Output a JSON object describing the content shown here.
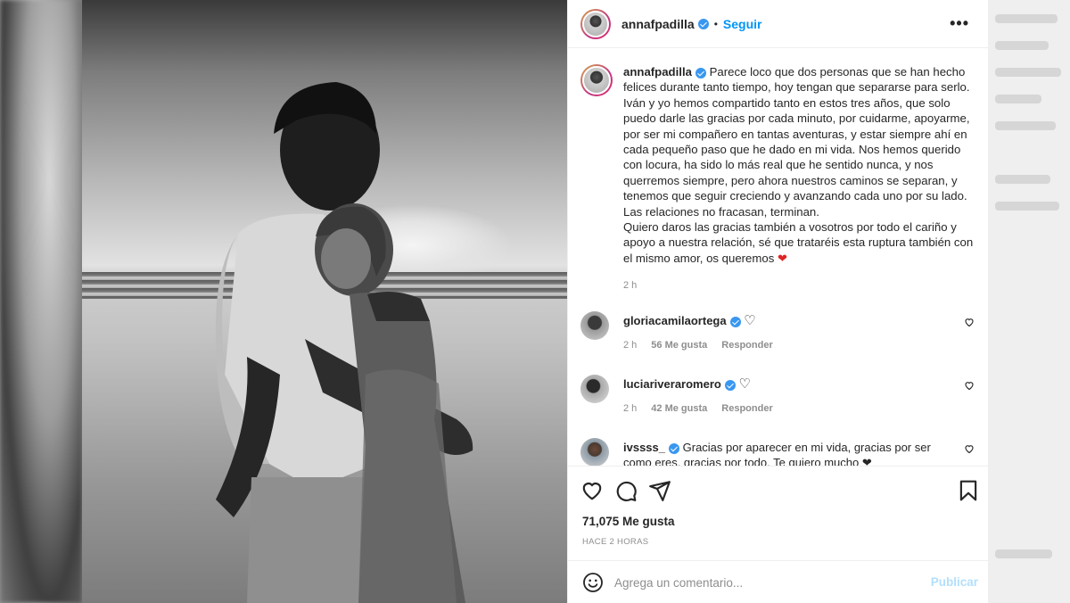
{
  "post": {
    "author": "annafpadilla",
    "follow_label": "Seguir",
    "separator": "•",
    "more_label": "•••",
    "caption_author": "annafpadilla",
    "caption": "Parece loco que dos personas que se han hecho felices durante tanto tiempo, hoy tengan que separarse para serlo. Iván y yo hemos compartido tanto en estos tres años, que solo puedo darle las gracias por cada minuto, por cuidarme, apoyarme, por ser mi compañero en tantas aventuras, y estar siempre ahí en cada pequeño paso que he dado en mi vida. Nos hemos querido con locura, ha sido lo más real que he sentido nunca, y nos querremos siempre, pero ahora nuestros caminos se separan, y tenemos que seguir creciendo y avanzando cada uno por su lado.",
    "caption_line2": "Las relaciones no fracasan, terminan.",
    "caption_line3": "Quiero daros las gracias también a vosotros por todo el cariño y apoyo a nuestra relación, sé que trataréis esta ruptura también con el mismo amor, os queremos",
    "caption_emoji": "❤",
    "caption_time": "2 h",
    "likes": "71,075 Me gusta",
    "posted_ago": "HACE 2 HORAS"
  },
  "comments": [
    {
      "user": "gloriacamilaortega",
      "text": "",
      "verified": true,
      "emoji": "♡",
      "time": "2 h",
      "likes": "56 Me gusta",
      "reply": "Responder"
    },
    {
      "user": "luciariveraromero",
      "text": "",
      "verified": true,
      "emoji": "♡",
      "time": "2 h",
      "likes": "42 Me gusta",
      "reply": "Responder"
    },
    {
      "user": "ivssss_",
      "text": "Gracias por aparecer en mi vida, gracias por ser como eres, gracias por todo. Te quiero mucho ❤",
      "verified": true
    }
  ],
  "add_comment": {
    "placeholder": "Agrega un comentario...",
    "publish_label": "Publicar"
  },
  "icons": [
    "heart-icon",
    "comment-icon",
    "share-icon",
    "bookmark-icon",
    "emoji-icon",
    "more-icon",
    "verified-badge"
  ],
  "colors": {
    "accent": "#0095f6",
    "verified": "#3897f0",
    "heart": "#e02424",
    "muted": "#8e8e8e",
    "text": "#262626"
  }
}
